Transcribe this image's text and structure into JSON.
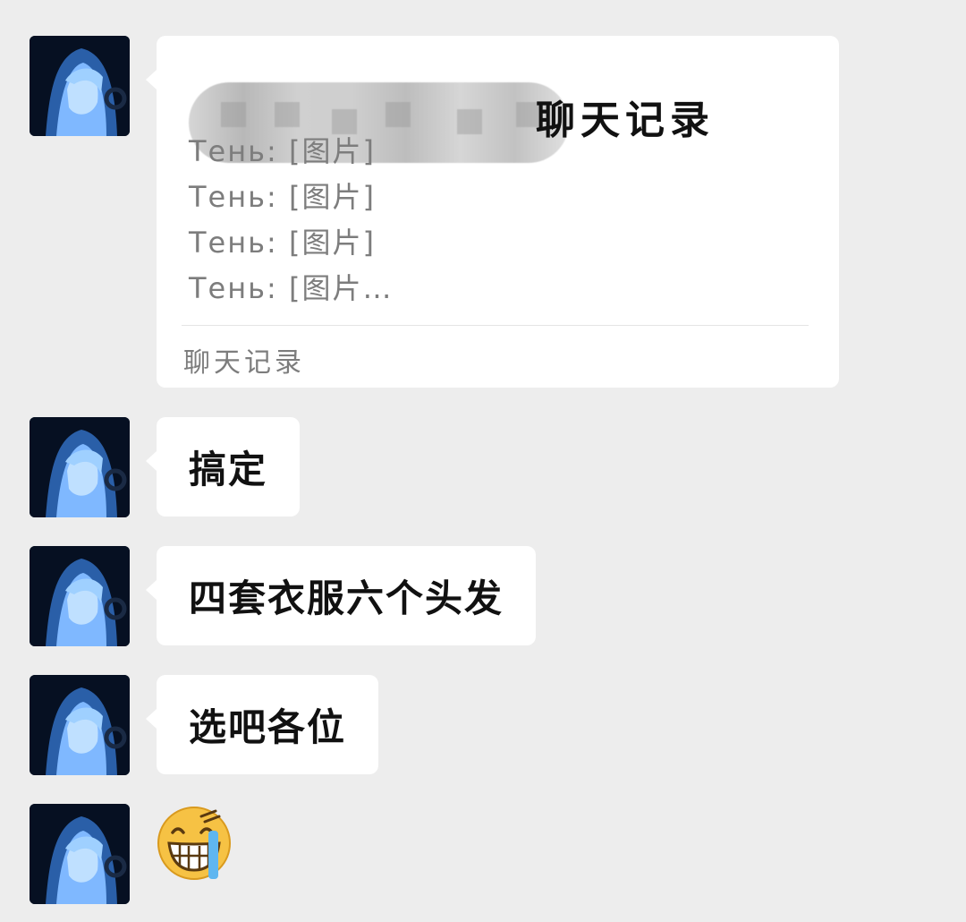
{
  "messages": [
    {
      "type": "chat_record",
      "title": "聊天记录",
      "lines": [
        "Тень: [图片]",
        "Тень: [图片]",
        "Тень: [图片]",
        "Тень: [图片…"
      ],
      "footer": "聊天记录"
    },
    {
      "type": "text",
      "text": "搞定"
    },
    {
      "type": "text",
      "text": "四套衣服六个头发"
    },
    {
      "type": "text",
      "text": "选吧各位"
    },
    {
      "type": "emoji",
      "emoji": "grinning-sweat-tears-emoji"
    }
  ],
  "colors": {
    "background": "#ededed",
    "bubble": "#ffffff",
    "secondary_text": "#7d7d7d",
    "avatar_hair": "#7fb8ff"
  }
}
